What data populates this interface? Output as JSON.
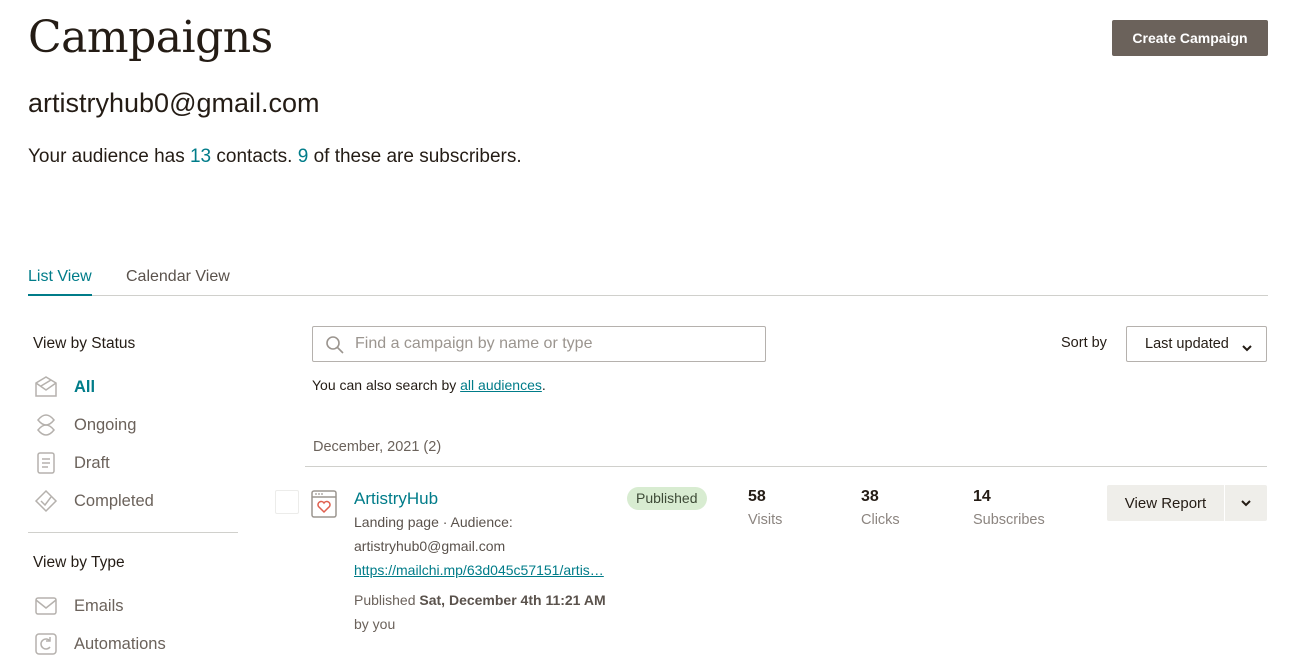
{
  "header": {
    "title": "Campaigns",
    "create_button": "Create Campaign",
    "account_email": "artistryhub0@gmail.com"
  },
  "audience": {
    "text_1": "Your audience has ",
    "contacts": "13",
    "text_2": " contacts. ",
    "subscribers": "9",
    "text_3": " of these are subscribers."
  },
  "tabs": [
    {
      "label": "List View",
      "active": true
    },
    {
      "label": "Calendar View",
      "active": false
    }
  ],
  "sidebar": {
    "status_heading": "View by Status",
    "status_items": [
      {
        "label": "All",
        "icon": "all-campaigns-icon",
        "active": true
      },
      {
        "label": "Ongoing",
        "icon": "ongoing-icon"
      },
      {
        "label": "Draft",
        "icon": "draft-icon"
      },
      {
        "label": "Completed",
        "icon": "completed-icon"
      }
    ],
    "type_heading": "View by Type",
    "type_items": [
      {
        "label": "Emails",
        "icon": "email-icon"
      },
      {
        "label": "Automations",
        "icon": "automation-icon"
      }
    ]
  },
  "search": {
    "placeholder": "Find a campaign by name or type",
    "hint_prefix": "You can also search by ",
    "hint_link": "all audiences",
    "hint_suffix": "."
  },
  "sort": {
    "label": "Sort by",
    "value": "Last updated"
  },
  "groups": [
    {
      "heading": "December, 2021 (2)",
      "campaigns": [
        {
          "name": "ArtistryHub",
          "type_line": "Landing page · Audience:",
          "audience": "artistryhub0@gmail.com",
          "url": "https://mailchi.mp/63d045c57151/artis…",
          "published_prefix": "Published ",
          "published_date": "Sat, December 4th 11:21 AM",
          "by": "by you",
          "status": "Published",
          "stats": [
            {
              "value": "58",
              "label": "Visits"
            },
            {
              "value": "38",
              "label": "Clicks"
            },
            {
              "value": "14",
              "label": "Subscribes"
            }
          ],
          "action_label": "View Report"
        }
      ]
    }
  ],
  "colors": {
    "accent": "#007c89",
    "primary_button": "#6b625b",
    "badge_bg": "#d8ecd1"
  }
}
